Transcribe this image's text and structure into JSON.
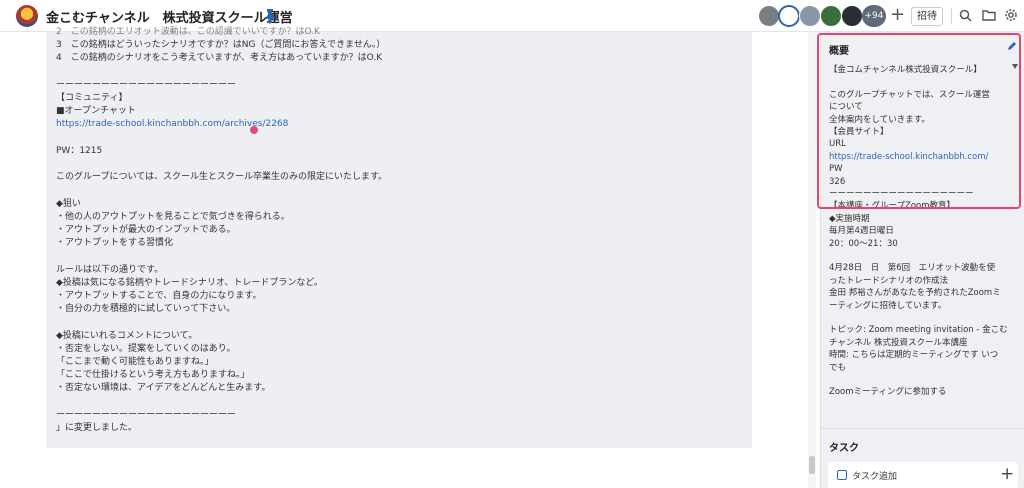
{
  "header": {
    "title": "金こむチャンネル　株式投資スクール運営",
    "more_members": "+94",
    "invite_label": "招待"
  },
  "message": {
    "lines": [
      "2　この銘柄のエリオット波動は、この認識でいいですか？はO.K",
      "3　この銘柄はどういったシナリオですか？はNG（ご質問にお答えできません。）",
      "4　この銘柄のシナリオをこう考えていますが、考え方はあっていますか？はO.K",
      "",
      "ーーーーーーーーーーーーーーーーーーーー",
      "【コミュニティ】",
      "■オープンチャット",
      "https://trade-school.kinchanbbh.com/archives/2268",
      "",
      "PW：1215",
      "",
      "このグループについては、スクール生とスクール卒業生のみの限定にいたします。",
      "",
      "◆狙い",
      "・他の人のアウトプットを見ることで気づきを得られる。",
      "・アウトプットが最大のインプットである。",
      "・アウトプットをする習慣化",
      "",
      "ルールは以下の通りです。",
      "◆投稿は気になる銘柄やトレードシナリオ、トレードプランなど。",
      "・アウトプットすることで、自身の力になります。",
      "・自分の力を積極的に試していって下さい。",
      "",
      "◆投稿にいれるコメントについて。",
      "・否定をしない。提案をしていくのはあり。",
      "「ここまで動く可能性もありますね。」",
      "「ここで仕掛けるという考え方もありますね。」",
      "・否定ない環境は、アイデアをどんどんと生みます。",
      "",
      "ーーーーーーーーーーーーーーーーーーーー",
      "」に変更しました。"
    ]
  },
  "sidebar": {
    "overview_title": "概要",
    "overview_lines": [
      "【金コムチャンネル株式投資スクール】",
      "",
      "このグループチャットでは、スクール運営",
      "について",
      "全体案内をしていきます。",
      "【会員サイト】",
      "URL",
      "https://trade-school.kinchanbbh.com/",
      "PW",
      "326",
      "ーーーーーーーーーーーーーーーーー",
      "【本講座・グループZoom教育】",
      "◆実施時期",
      "毎月第4週日曜日",
      "20：00〜21：30",
      "",
      "4月28日　日　第6回　エリオット波動を使",
      "ったトレードシナリオの作成法",
      "金田 邦裕さんがあなたを予約されたZoomミ",
      "ーティングに招待しています。",
      "",
      "トピック: Zoom meeting invitation - 金こむ",
      "チャンネル 株式投資スクール本講座",
      "時間: こちらは定期的ミーティングです いつ",
      "でも",
      "",
      "Zoomミーティングに参加する"
    ],
    "task_title": "タスク",
    "task_add_label": "タスク追加"
  }
}
